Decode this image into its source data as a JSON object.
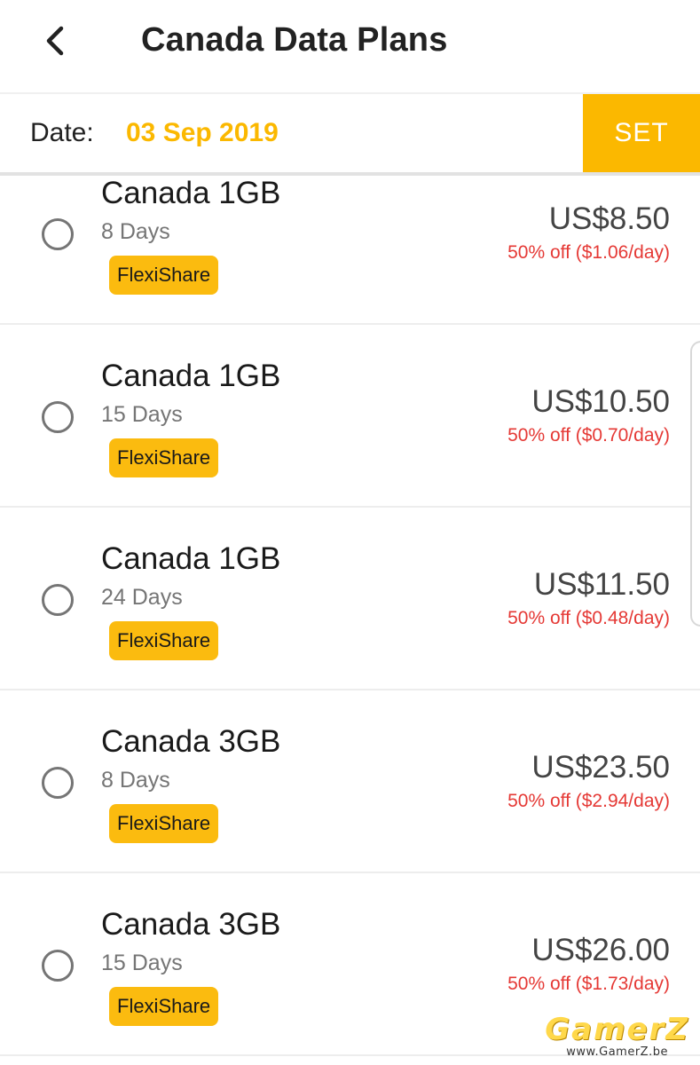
{
  "header": {
    "title": "Canada Data Plans",
    "back_icon": "back-arrow-icon"
  },
  "date_bar": {
    "label": "Date:",
    "value": "03 Sep 2019",
    "set_label": "SET"
  },
  "plans": [
    {
      "name": "Canada 1GB",
      "days": "8 Days",
      "badge": "FlexiShare",
      "price": "US$8.50",
      "discount": "50% off ($1.06/day)"
    },
    {
      "name": "Canada 1GB",
      "days": "15 Days",
      "badge": "FlexiShare",
      "price": "US$10.50",
      "discount": "50% off ($0.70/day)"
    },
    {
      "name": "Canada 1GB",
      "days": "24 Days",
      "badge": "FlexiShare",
      "price": "US$11.50",
      "discount": "50% off ($0.48/day)"
    },
    {
      "name": "Canada 3GB",
      "days": "8 Days",
      "badge": "FlexiShare",
      "price": "US$23.50",
      "discount": "50% off ($2.94/day)"
    },
    {
      "name": "Canada 3GB",
      "days": "15 Days",
      "badge": "FlexiShare",
      "price": "US$26.00",
      "discount": "50% off ($1.73/day)"
    }
  ],
  "watermark": {
    "logo": "GamerZ",
    "url": "www.GamerZ.be"
  },
  "colors": {
    "accent": "#fbb800",
    "discount": "#e53935",
    "radio": "#757575"
  }
}
